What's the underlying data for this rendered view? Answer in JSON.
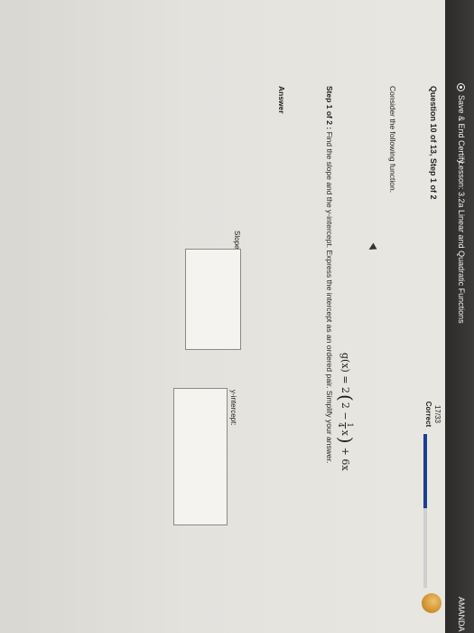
{
  "header": {
    "save_end_label": "Save & End Certify",
    "lesson_title": "Lesson: 3.2a Linear and Quadratic Functions",
    "user_name": "AMANDA C"
  },
  "question": {
    "header": "Question 10 of 13, Step 1 of 2",
    "score": "17/33",
    "status": "Correct",
    "progress_percent": 48
  },
  "content": {
    "consider": "Consider the following function.",
    "formula": {
      "lhs": "g(x) = 2",
      "inner": "2 −",
      "frac_num": "1",
      "frac_den": "4",
      "inner_var": "x",
      "rhs": "+ 6x"
    },
    "step_label": "Step 1 of 2 :",
    "step_text": "Find the slope and the y-intercept. Express the intercept as an ordered pair. Simplify your answer.",
    "answer_label": "Answer"
  },
  "answer": {
    "slope_label": "Slope:",
    "slope_value": "",
    "yint_label": "y-intercept:",
    "yint_value": ""
  },
  "colors": {
    "topbar": "#2c2b29",
    "progress": "#1c3f8e",
    "badge": "#c98c2a"
  }
}
